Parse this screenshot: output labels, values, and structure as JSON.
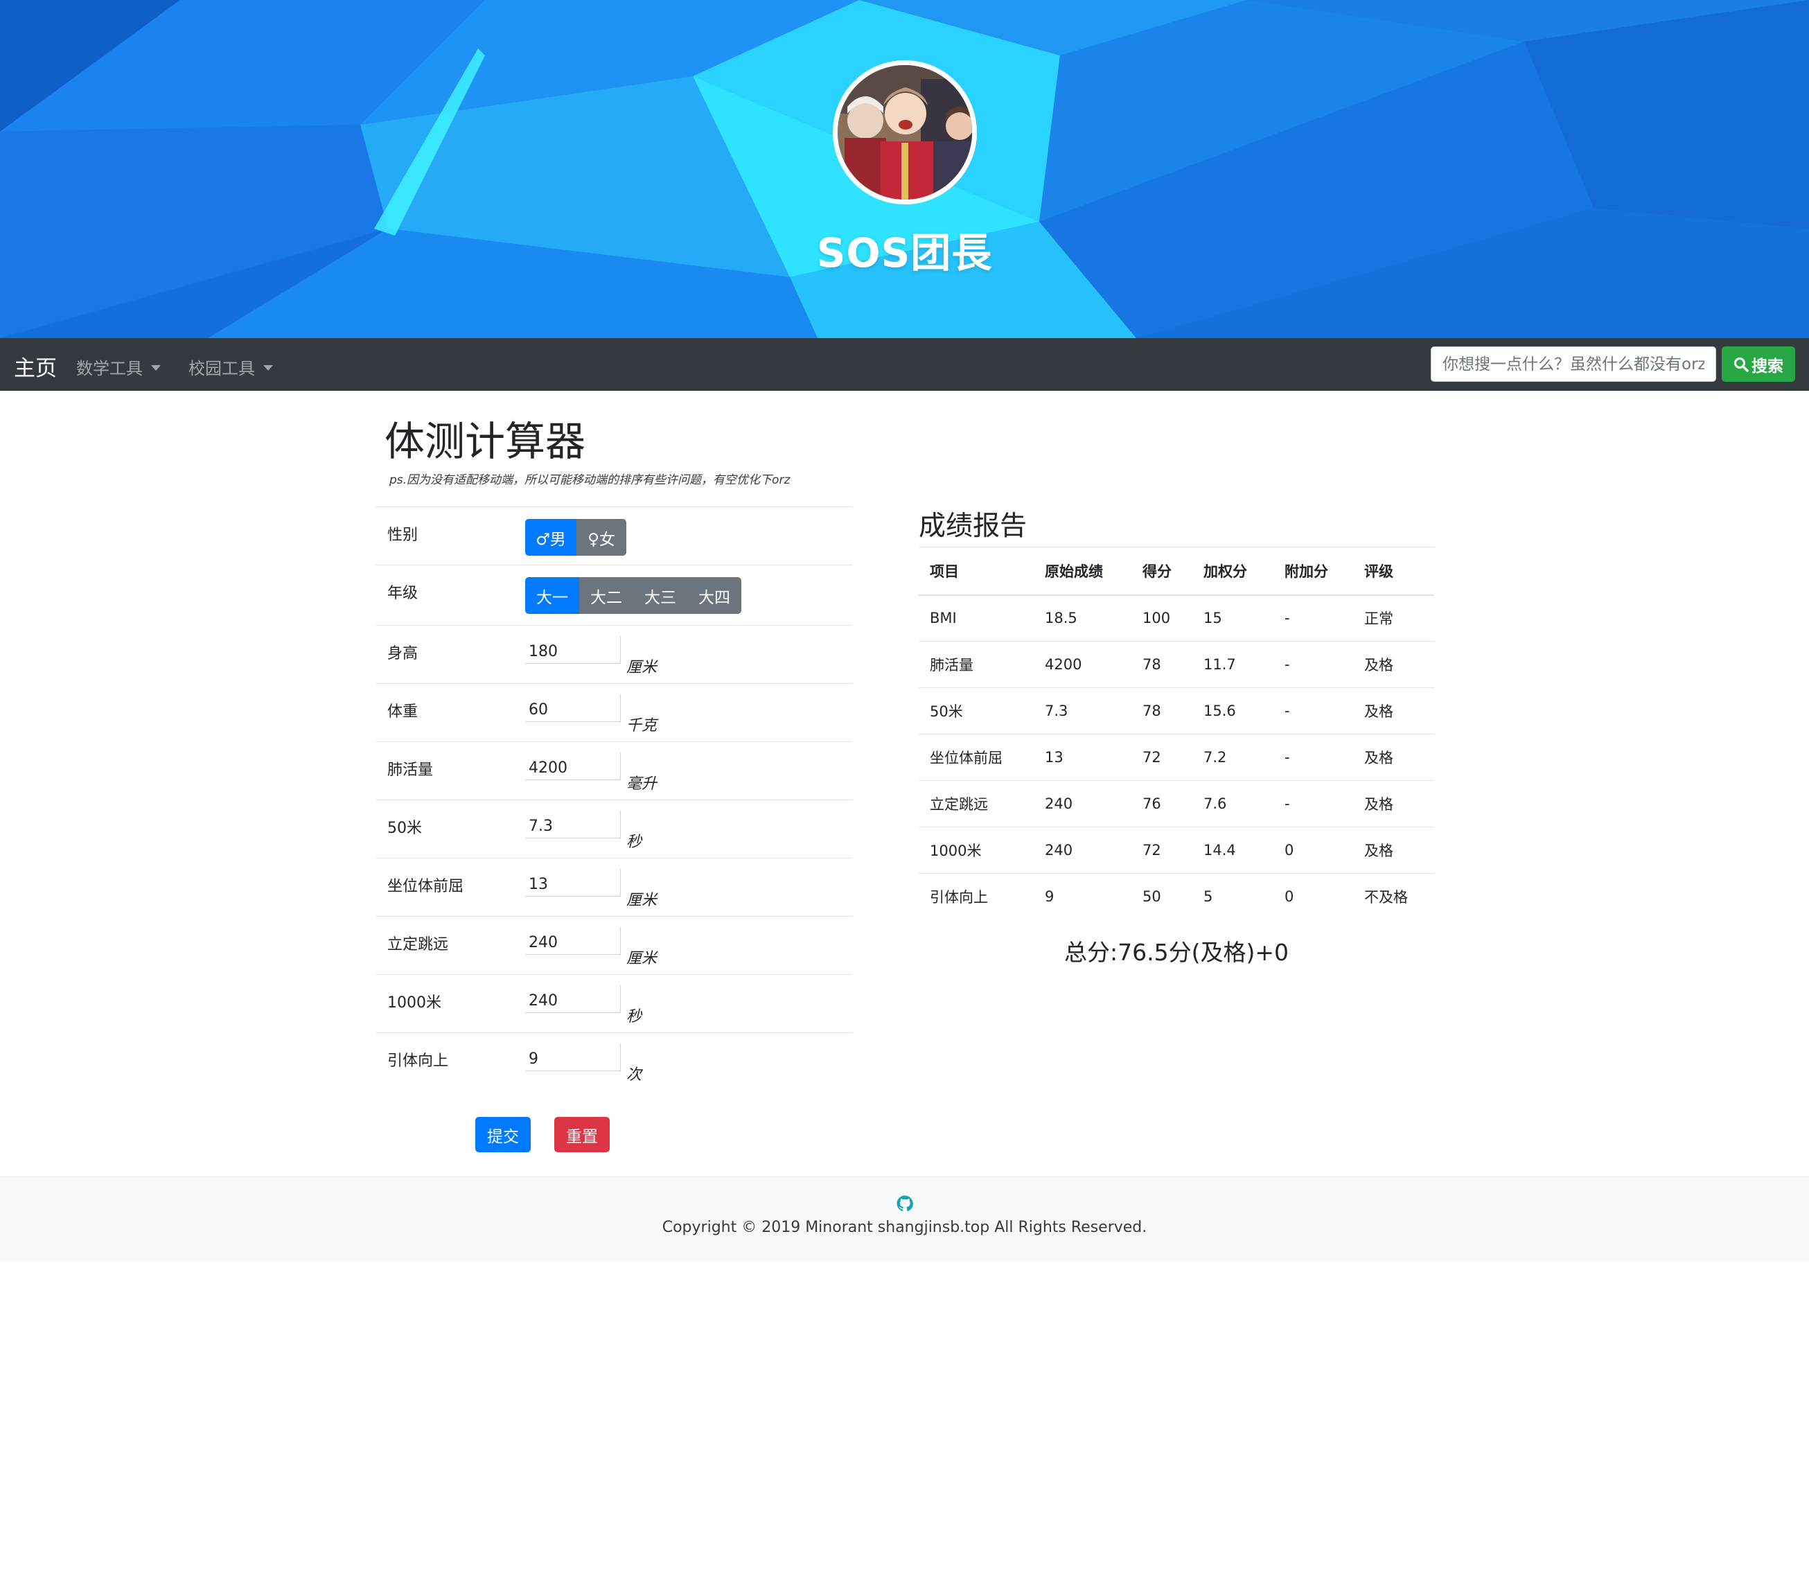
{
  "header": {
    "site_title": "SOS团長",
    "avatar_alt": "avatar"
  },
  "navbar": {
    "brand": "主页",
    "menus": [
      "数学工具",
      "校园工具"
    ],
    "search_placeholder": "你想搜一点什么？虽然什么都没有orz",
    "search_button": "搜索"
  },
  "form": {
    "title": "体测计算器",
    "note": "ps.因为没有适配移动端，所以可能移动端的排序有些许问题，有空优化下orz",
    "gender": {
      "label": "性别",
      "options": [
        "♂男",
        "♀女"
      ],
      "selected": "♂男"
    },
    "grade": {
      "label": "年级",
      "options": [
        "大一",
        "大二",
        "大三",
        "大四"
      ],
      "selected": "大一"
    },
    "fields": [
      {
        "label": "身高",
        "value": "180",
        "unit": "厘米"
      },
      {
        "label": "体重",
        "value": "60",
        "unit": "千克"
      },
      {
        "label": "肺活量",
        "value": "4200",
        "unit": "毫升"
      },
      {
        "label": "50米",
        "value": "7.3",
        "unit": "秒"
      },
      {
        "label": "坐位体前屈",
        "value": "13",
        "unit": "厘米"
      },
      {
        "label": "立定跳远",
        "value": "240",
        "unit": "厘米"
      },
      {
        "label": "1000米",
        "value": "240",
        "unit": "秒"
      },
      {
        "label": "引体向上",
        "value": "9",
        "unit": "次"
      }
    ],
    "submit_label": "提交",
    "reset_label": "重置"
  },
  "report": {
    "title": "成绩报告",
    "columns": [
      "项目",
      "原始成绩",
      "得分",
      "加权分",
      "附加分",
      "评级"
    ],
    "rows": [
      [
        "BMI",
        "18.5",
        "100",
        "15",
        "-",
        "正常"
      ],
      [
        "肺活量",
        "4200",
        "78",
        "11.7",
        "-",
        "及格"
      ],
      [
        "50米",
        "7.3",
        "78",
        "15.6",
        "-",
        "及格"
      ],
      [
        "坐位体前屈",
        "13",
        "72",
        "7.2",
        "-",
        "及格"
      ],
      [
        "立定跳远",
        "240",
        "76",
        "7.6",
        "-",
        "及格"
      ],
      [
        "1000米",
        "240",
        "72",
        "14.4",
        "0",
        "及格"
      ],
      [
        "引体向上",
        "9",
        "50",
        "5",
        "0",
        "不及格"
      ]
    ],
    "total": "总分:76.5分(及格)+0"
  },
  "footer": {
    "copyright": "Copyright © 2019 Minorant shangjinsb.top All Rights Reserved.",
    "icon": "github-icon"
  },
  "colors": {
    "primary": "#007bff",
    "secondary": "#6c757d",
    "success": "#28a745",
    "danger": "#dc3545",
    "navbar": "#343a40",
    "hero_blue": "#1a7ae6",
    "hero_cyan": "#2de6ff"
  }
}
